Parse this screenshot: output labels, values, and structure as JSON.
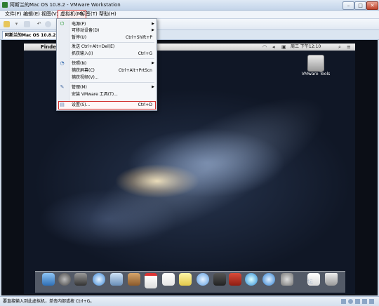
{
  "window": {
    "title": "阿斯兰的Mac OS 10.8.2 - VMware Workstation",
    "min_label": "–",
    "max_label": "□",
    "close_label": "✕"
  },
  "menubar": {
    "items": [
      "文件(F)",
      "编辑(E)",
      "视图(V)",
      "虚拟机(M)",
      "标签(T)",
      "帮助(H)"
    ],
    "active_index": 3
  },
  "toolbar": {
    "icons": [
      "library-icon",
      "snapshot-icon",
      "revert-icon",
      "manager-icon"
    ]
  },
  "tab": {
    "label": "阿斯兰的Mac OS 10.8.2",
    "close_label": "✕"
  },
  "vm_menu": {
    "items": [
      {
        "label": "电源(P)",
        "shortcut": "",
        "submenu": true,
        "icon": "power-icon"
      },
      {
        "label": "可移动设备(D)",
        "shortcut": "",
        "submenu": true,
        "icon": ""
      },
      {
        "label": "暂停(U)",
        "shortcut": "Ctrl+Shift+P",
        "submenu": false,
        "icon": ""
      },
      {
        "label": "发送 Ctrl+Alt+Del(E)",
        "shortcut": "",
        "submenu": false,
        "icon": ""
      },
      {
        "label": "抓获输入(I)",
        "shortcut": "Ctrl+G",
        "submenu": false,
        "icon": ""
      },
      {
        "label": "快照(N)",
        "shortcut": "",
        "submenu": true,
        "icon": "snapshot-icon"
      },
      {
        "label": "捕获屏幕(C)",
        "shortcut": "Ctrl+Alt+PrtScn",
        "submenu": false,
        "icon": ""
      },
      {
        "label": "捕获视频(V)...",
        "shortcut": "",
        "submenu": false,
        "icon": ""
      },
      {
        "label": "管理(M)",
        "shortcut": "",
        "submenu": true,
        "icon": "wrench-icon"
      },
      {
        "label": "安装 VMware 工具(T)...",
        "shortcut": "",
        "submenu": false,
        "icon": ""
      },
      {
        "label": "设置(S)...",
        "shortcut": "Ctrl+D",
        "submenu": false,
        "icon": "settings-icon"
      }
    ]
  },
  "mac": {
    "finder_label": "Finder",
    "clock": "周三 下午12:10",
    "vmtools_label": "VMware Tools"
  },
  "statusbar": {
    "text": "要直接输入到此虚拟机，单击内部或按 Ctrl+G。"
  },
  "watermark": "坛",
  "colors": {
    "highlight_red": "#d2302e",
    "titlebar": "#c4d5ea"
  }
}
